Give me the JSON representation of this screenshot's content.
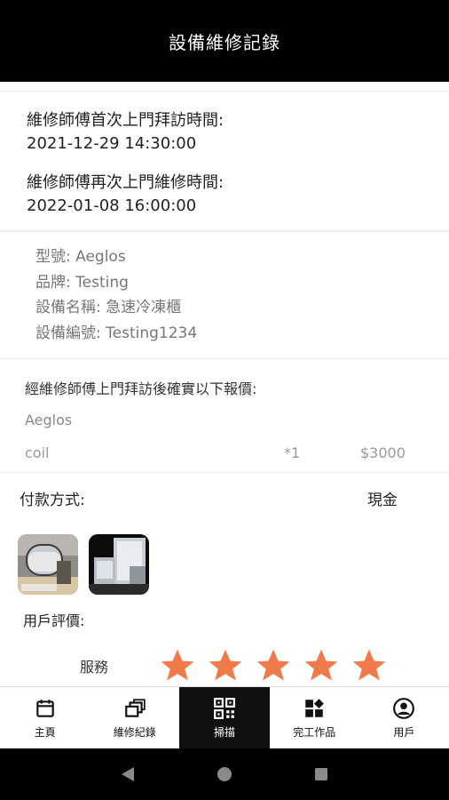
{
  "header": {
    "title": "設備維修記錄"
  },
  "visit": {
    "first_label": "維修師傅首次上門拜訪時間:",
    "first_value": "2021-12-29 14:30:00",
    "second_label": "維修師傅再次上門維修時間:",
    "second_value": "2022-01-08 16:00:00"
  },
  "device": {
    "model": "型號:  Aeglos",
    "brand": "品牌: Testing",
    "name": "設備名稱: 急速冷凍櫃",
    "serial": "設備編號: Testing1234"
  },
  "quote": {
    "intro": "經維修師傅上門拜訪後確實以下報價:",
    "model": "Aeglos",
    "items": [
      {
        "name": "coil",
        "qty": "*1",
        "price": "$3000"
      }
    ]
  },
  "payment": {
    "label": "付款方式:",
    "value": "現金"
  },
  "photos": [
    "mirror-cabinet-photo",
    "kitchen-appliance-photo"
  ],
  "review": {
    "label": "用戶評價:",
    "service_label": "服務",
    "star_count": 5,
    "star_color": "#f07a4a"
  },
  "nav": {
    "items": [
      {
        "label": "主頁",
        "icon": "calendar-icon"
      },
      {
        "label": "維修紀錄",
        "icon": "boxes-icon"
      },
      {
        "label": "掃描",
        "icon": "qr-code-icon"
      },
      {
        "label": "完工作品",
        "icon": "dashboard-icon"
      },
      {
        "label": "用戶",
        "icon": "user-icon"
      }
    ],
    "active": "掃描"
  },
  "system_nav": {
    "buttons": [
      "back-icon",
      "home-icon",
      "recents-icon"
    ]
  },
  "colors": {
    "header_bg": "#000000",
    "accent_star": "#f07a4a",
    "nav_active_bg": "#111111"
  }
}
